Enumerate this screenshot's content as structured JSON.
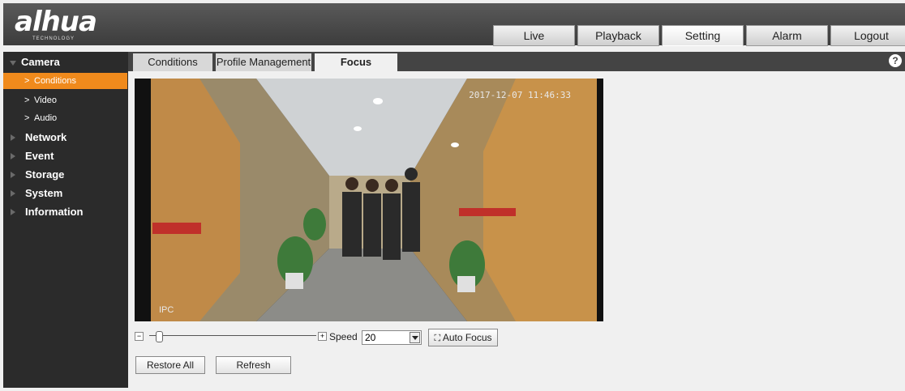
{
  "brand": {
    "logo": "alhua",
    "sub": "TECHNOLOGY"
  },
  "nav": {
    "tabs": [
      "Live",
      "Playback",
      "Setting",
      "Alarm",
      "Logout"
    ],
    "active": "Setting"
  },
  "sidebar": {
    "items": [
      {
        "label": "Camera",
        "type": "group",
        "expanded": true
      },
      {
        "label": "Conditions",
        "type": "sub",
        "active": true
      },
      {
        "label": "Video",
        "type": "sub"
      },
      {
        "label": "Audio",
        "type": "sub"
      },
      {
        "label": "Network",
        "type": "group"
      },
      {
        "label": "Event",
        "type": "group"
      },
      {
        "label": "Storage",
        "type": "group"
      },
      {
        "label": "System",
        "type": "group"
      },
      {
        "label": "Information",
        "type": "group"
      }
    ]
  },
  "subtabs": {
    "items": [
      "Conditions",
      "Profile Management",
      "Focus"
    ],
    "active": "Focus",
    "help": "?"
  },
  "video": {
    "timestamp": "2017-12-07 11:46:33",
    "channel": "IPC"
  },
  "focus": {
    "zoom_minus": "−",
    "zoom_plus": "+",
    "speed_label": "Speed",
    "speed_value": "20",
    "auto_focus_label": "Auto Focus",
    "zoom_level_fraction": 0.06
  },
  "actions": {
    "restore_all": "Restore All",
    "refresh": "Refresh"
  },
  "colors": {
    "accent": "#f08a1c",
    "sidebar": "#2b2b2b",
    "topbar": "#444444"
  }
}
